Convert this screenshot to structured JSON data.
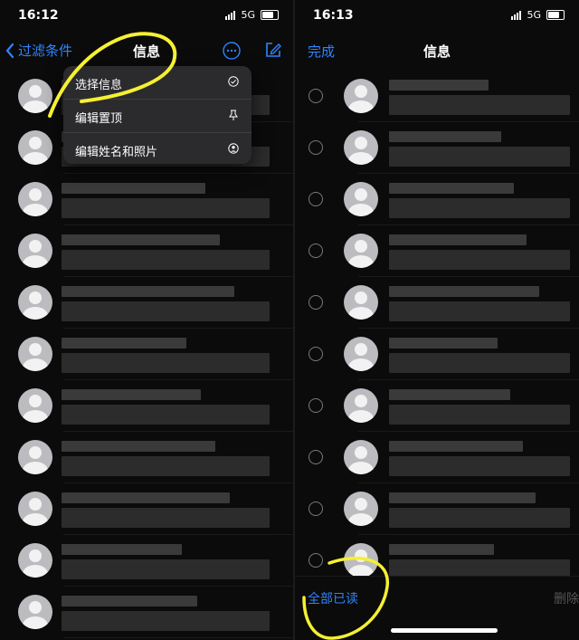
{
  "left": {
    "status": {
      "time": "16:12",
      "network": "5G"
    },
    "nav": {
      "back_label": "过滤条件",
      "title": "信息"
    },
    "menu": [
      {
        "label": "选择信息",
        "icon": "checkmark-circle-icon"
      },
      {
        "label": "编辑置顶",
        "icon": "pin-icon"
      },
      {
        "label": "编辑姓名和照片",
        "icon": "person-circle-icon"
      }
    ]
  },
  "right": {
    "status": {
      "time": "16:13",
      "network": "5G"
    },
    "nav": {
      "done_label": "完成",
      "title": "信息"
    },
    "toolbar": {
      "read_all_label": "全部已读",
      "delete_label": "删除"
    }
  },
  "colors": {
    "accent": "#2f84ff",
    "annotation": "#f5f032",
    "menu_bg": "#2b2b2d"
  }
}
